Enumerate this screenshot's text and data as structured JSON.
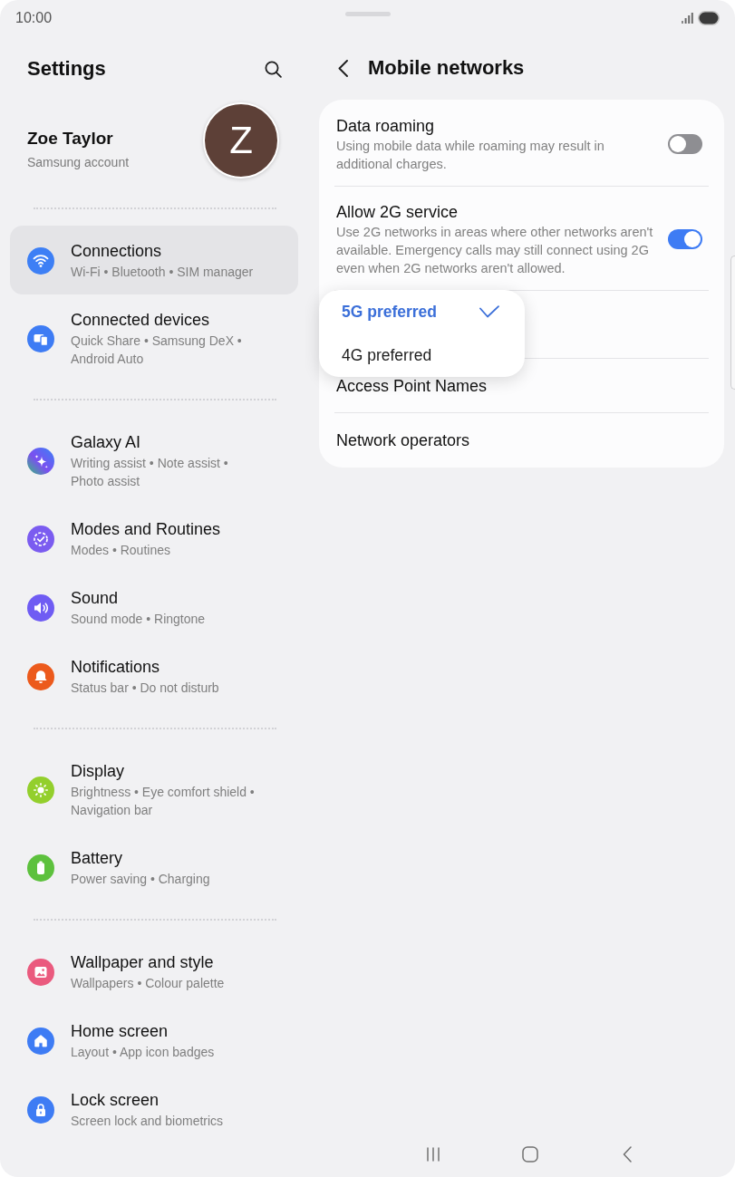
{
  "status_bar": {
    "time": "10:00"
  },
  "sidebar": {
    "title": "Settings",
    "profile": {
      "name": "Zoe Taylor",
      "account": "Samsung account",
      "initial": "Z"
    },
    "groups": [
      {
        "items": [
          {
            "kind": "wifi",
            "title": "Connections",
            "subtitle": "Wi-Fi • Bluetooth • SIM manager",
            "selected": true
          },
          {
            "kind": "devices",
            "title": "Connected devices",
            "subtitle": "Quick Share • Samsung DeX • Android Auto",
            "selected": false
          }
        ]
      },
      {
        "items": [
          {
            "kind": "sparkle",
            "title": "Galaxy AI",
            "subtitle": "Writing assist • Note assist • Photo assist",
            "selected": false
          },
          {
            "kind": "modes",
            "title": "Modes and Routines",
            "subtitle": "Modes • Routines",
            "selected": false
          },
          {
            "kind": "sound",
            "title": "Sound",
            "subtitle": "Sound mode • Ringtone",
            "selected": false
          },
          {
            "kind": "bell",
            "title": "Notifications",
            "subtitle": "Status bar • Do not disturb",
            "selected": false
          }
        ]
      },
      {
        "items": [
          {
            "kind": "sun",
            "title": "Display",
            "subtitle": "Brightness • Eye comfort shield • Navigation bar",
            "selected": false
          },
          {
            "kind": "battery",
            "title": "Battery",
            "subtitle": "Power saving • Charging",
            "selected": false
          }
        ]
      },
      {
        "items": [
          {
            "kind": "image",
            "title": "Wallpaper and style",
            "subtitle": "Wallpapers • Colour palette",
            "selected": false
          },
          {
            "kind": "home",
            "title": "Home screen",
            "subtitle": "Layout • App icon badges",
            "selected": false
          },
          {
            "kind": "lock",
            "title": "Lock screen",
            "subtitle": "Screen lock and biometrics",
            "selected": false
          }
        ]
      }
    ]
  },
  "detail": {
    "title": "Mobile networks",
    "rows": [
      {
        "kind": "toggle",
        "title": "Data roaming",
        "description": "Using mobile data while roaming may result in additional charges.",
        "on": false
      },
      {
        "kind": "toggle",
        "title": "Allow 2G service",
        "description": "Use 2G networks in areas where other networks aren't available. Emergency calls may still connect using 2G even when 2G networks aren't allowed.",
        "on": true
      },
      {
        "kind": "dropdown",
        "menu": {
          "options": [
            {
              "label": "5G preferred",
              "selected": true
            },
            {
              "label": "4G preferred",
              "selected": false
            }
          ]
        }
      },
      {
        "kind": "link",
        "title": "Access Point Names"
      },
      {
        "kind": "link",
        "title": "Network operators"
      }
    ]
  }
}
